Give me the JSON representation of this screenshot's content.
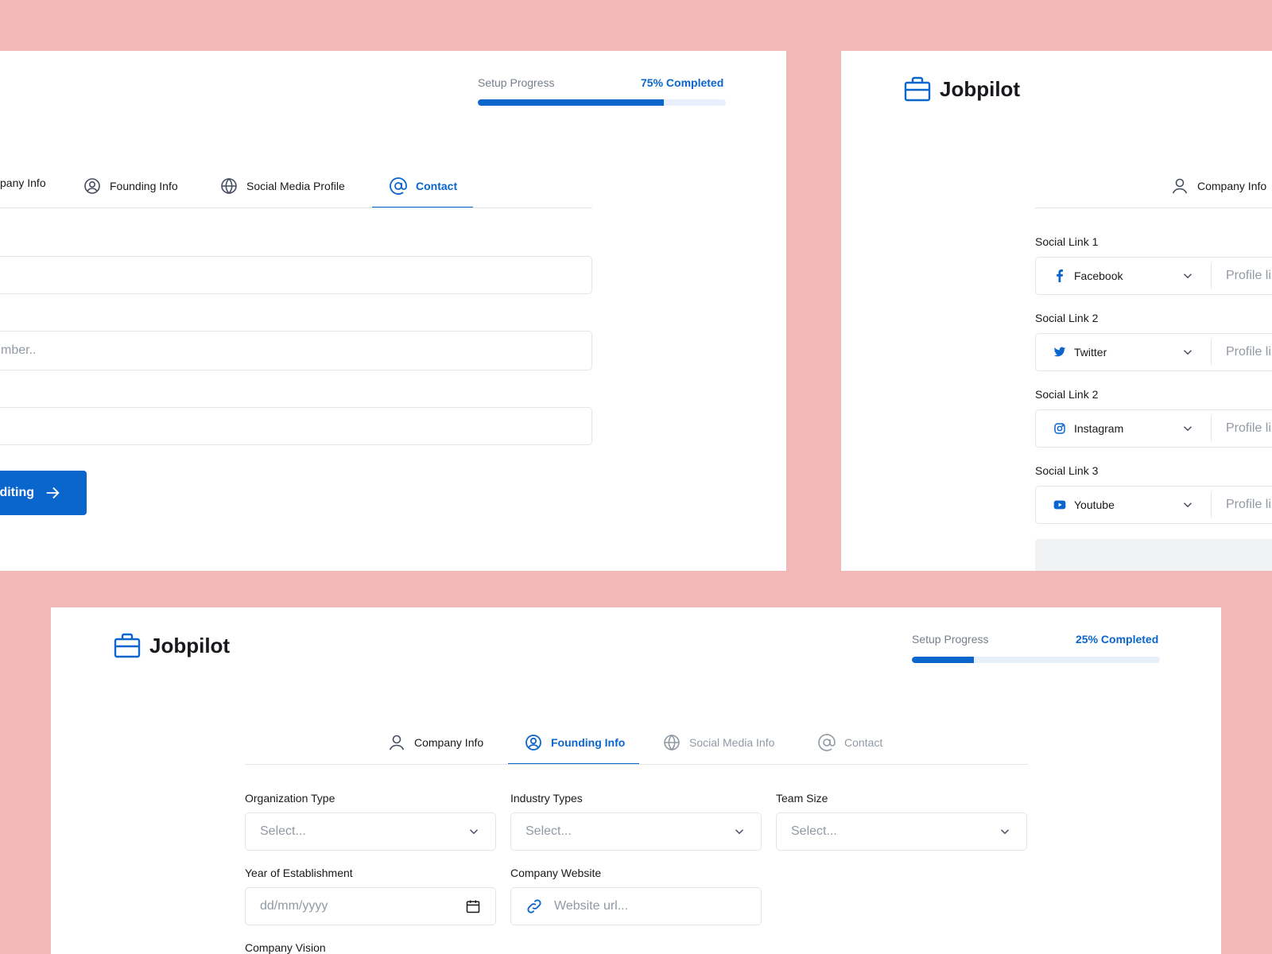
{
  "panel_a": {
    "progress": {
      "label": "Setup Progress",
      "value_text": "75% Completed",
      "fraction": 0.75
    },
    "tabs": [
      {
        "label": "pany Info",
        "icon": "user-icon",
        "state": "normal"
      },
      {
        "label": "Founding Info",
        "icon": "user-circle-icon",
        "state": "normal"
      },
      {
        "label": "Social Media Profile",
        "icon": "globe-icon",
        "state": "normal"
      },
      {
        "label": "Contact",
        "icon": "at-sign-icon",
        "state": "active"
      }
    ],
    "inputs": [
      {
        "placeholder": ""
      },
      {
        "placeholder": "mber.."
      },
      {
        "placeholder": ""
      }
    ],
    "button": {
      "label": "diting",
      "icon": "arrow-right-icon"
    }
  },
  "panel_b": {
    "logo": {
      "text": "Jobpilot",
      "icon": "briefcase-icon"
    },
    "tab": {
      "label": "Company Info",
      "icon": "user-icon"
    },
    "social_links": [
      {
        "label": "Social Link 1",
        "network": "Facebook",
        "icon": "facebook-icon",
        "placeholder": "Profile li"
      },
      {
        "label": "Social Link 2",
        "network": "Twitter",
        "icon": "twitter-icon",
        "placeholder": "Profile li"
      },
      {
        "label": "Social Link 2",
        "network": "Instagram",
        "icon": "instagram-icon",
        "placeholder": "Profile li"
      },
      {
        "label": "Social Link 3",
        "network": "Youtube",
        "icon": "youtube-icon",
        "placeholder": "Profile li"
      }
    ]
  },
  "panel_c": {
    "logo": {
      "text": "Jobpilot",
      "icon": "briefcase-icon"
    },
    "progress": {
      "label": "Setup Progress",
      "value_text": "25% Completed",
      "fraction": 0.25
    },
    "tabs": [
      {
        "label": "Company Info",
        "icon": "user-icon",
        "state": "normal"
      },
      {
        "label": "Founding Info",
        "icon": "user-circle-icon",
        "state": "active"
      },
      {
        "label": "Social Media Info",
        "icon": "globe-icon",
        "state": "disabled"
      },
      {
        "label": "Contact",
        "icon": "at-sign-icon",
        "state": "disabled"
      }
    ],
    "fields": {
      "organization_type": {
        "label": "Organization Type",
        "placeholder": "Select..."
      },
      "industry_types": {
        "label": "Industry Types",
        "placeholder": "Select..."
      },
      "team_size": {
        "label": "Team Size",
        "placeholder": "Select..."
      },
      "year_of_establishment": {
        "label": "Year of Establishment",
        "placeholder": "dd/mm/yyyy"
      },
      "company_website": {
        "label": "Company Website",
        "placeholder": "Website url..."
      },
      "company_vision": {
        "label": "Company Vision"
      }
    }
  },
  "colors": {
    "accent": "#0A65CC",
    "background": "#F2B8B8",
    "border": "#E4E5E8",
    "muted": "#9199A3"
  }
}
